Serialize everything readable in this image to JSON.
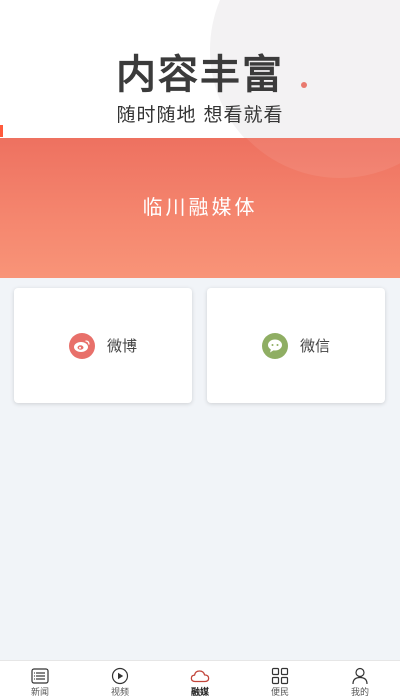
{
  "promo": {
    "title": "内容丰富",
    "subtitle": "随时随地 想看就看"
  },
  "header": {
    "title": "临川融媒体"
  },
  "cards": [
    {
      "label": "微博",
      "icon": "weibo-icon",
      "icon_color": "#e8706a"
    },
    {
      "label": "微信",
      "icon": "wechat-icon",
      "icon_color": "#8fae63"
    }
  ],
  "nav": {
    "items": [
      {
        "label": "新闻",
        "icon": "news-list-icon",
        "active": false
      },
      {
        "label": "视频",
        "icon": "play-icon",
        "active": false
      },
      {
        "label": "融媒",
        "icon": "cloud-icon",
        "active": true
      },
      {
        "label": "便民",
        "icon": "grid-icon",
        "active": false
      },
      {
        "label": "我的",
        "icon": "user-icon",
        "active": false
      }
    ]
  },
  "colors": {
    "accent": "#ee7160",
    "active_nav": "#c2443a",
    "weibo": "#e8706a",
    "wechat": "#8fae63"
  }
}
